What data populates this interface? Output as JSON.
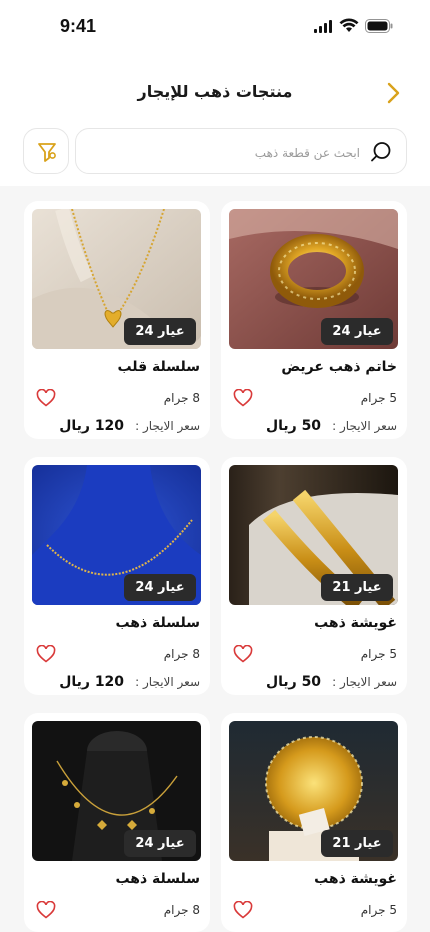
{
  "status": {
    "time": "9:41"
  },
  "header": {
    "title": "منتجات ذهب للإيجار"
  },
  "search": {
    "placeholder": "ابحث عن قطعة ذهب"
  },
  "products": [
    {
      "name": "خاتم ذهب عريض",
      "karat": "عيار 24",
      "weight": "5 جرام",
      "price_label": "سعر الايجار :",
      "price": "50 ريال",
      "image": "gold-wide-ring"
    },
    {
      "name": "سلسلة قلب",
      "karat": "عيار 24",
      "weight": "8 جرام",
      "price_label": "سعر الايجار :",
      "price": "120 ريال",
      "image": "gold-heart-necklace"
    },
    {
      "name": "غويشة ذهب",
      "karat": "عيار 21",
      "weight": "5 جرام",
      "price_label": "سعر الايجار :",
      "price": "50 ريال",
      "image": "gold-bangles"
    },
    {
      "name": "سلسلة ذهب",
      "karat": "عيار 24",
      "weight": "8 جرام",
      "price_label": "سعر الايجار :",
      "price": "120 ريال",
      "image": "gold-chain-on-blue"
    },
    {
      "name": "غويشة ذهب",
      "karat": "عيار 21",
      "weight": "5 جرام",
      "image": "gold-filigree-bangle"
    },
    {
      "name": "سلسلة ذهب",
      "karat": "عيار 24",
      "weight": "8 جرام",
      "image": "gold-charm-necklace"
    }
  ],
  "colors": {
    "accent": "#D9A21B",
    "heart": "#D93A3A",
    "badge": "#2B2B2B"
  },
  "icons": [
    "back-chevron-icon",
    "search-icon",
    "filter-icon",
    "heart-icon",
    "signal-icon",
    "wifi-icon",
    "battery-icon"
  ]
}
